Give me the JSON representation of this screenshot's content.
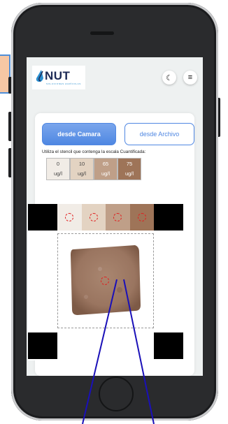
{
  "app": {
    "logo_text": "NUT",
    "logo_tagline": "SOLUCIONES AGRÍCOLAS"
  },
  "header": {
    "theme_icon": "moon-icon",
    "menu_icon": "hamburger-menu-icon"
  },
  "source_buttons": {
    "camera_label": "desde Camara",
    "file_label": "desde Archivo"
  },
  "instructions": "Utiliza el stencil que contenga la escala Cuantificada:",
  "stencil": {
    "cells": [
      {
        "value": "0",
        "unit": "ug/l",
        "color": "#f1ece6"
      },
      {
        "value": "10",
        "unit": "ug/l",
        "color": "#e3d3c2"
      },
      {
        "value": "65",
        "unit": "ug/l",
        "color": "#bf9f88"
      },
      {
        "value": "75",
        "unit": "ug/l",
        "color": "#9e7458"
      }
    ]
  },
  "viewer": {
    "swatch_colors": [
      "#f1ece6",
      "#e3d3c2",
      "#bf9f88",
      "#9e7458"
    ],
    "sample_color": "#a07e68"
  },
  "colors": {
    "accent": "#4f87e2",
    "marker": "#e02020",
    "annotation_line": "#1a10b8"
  }
}
